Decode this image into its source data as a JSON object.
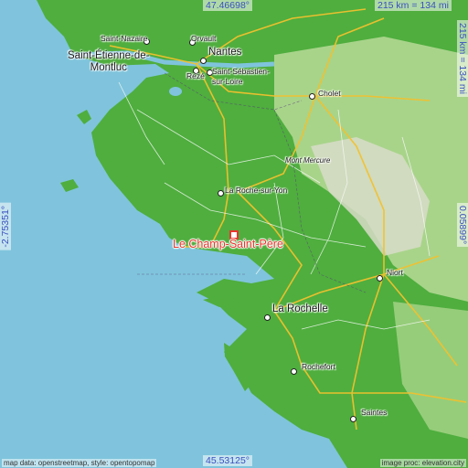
{
  "coordinates": {
    "top_latitude": "47.46698°",
    "bottom_latitude": "45.53125°",
    "left_longitude": "-2.75351°",
    "right_longitude": "0.05899°"
  },
  "scale": {
    "horizontal": "215 km = 134 mi",
    "vertical": "215 km = 134 mi"
  },
  "places": {
    "saint_nazaire": "Saint-Nazaire",
    "orvault": "Orvault",
    "nantes": "Nantes",
    "saint_etienne": "Saint-Étienne-de-\nMontluc",
    "reze": "Rezé",
    "saint_sebastien": "Saint-Sébastien-\nsur-Loire",
    "cholet": "Cholet",
    "mont_mercure": "Mont Mercure",
    "la_roche_sur_yon": "La Roche-sur-Yon",
    "le_champ_saint_pere": "Le Champ-Saint-Père",
    "niort": "Niort",
    "la_rochelle": "La Rochelle",
    "rochefort": "Rochefort",
    "saintes": "Saintes"
  },
  "attribution": {
    "left": "map data: openstreetmap, style: opentopomap",
    "right": "image proc: elevation.city"
  },
  "colors": {
    "sea": "#7fc4dc",
    "lowland": "#4fae3e",
    "upland": "#a8d48a",
    "highland": "#d8dcc8",
    "roads": "#f2c12e",
    "marker": "#e8362c",
    "coord_text": "#3a4fbf"
  }
}
